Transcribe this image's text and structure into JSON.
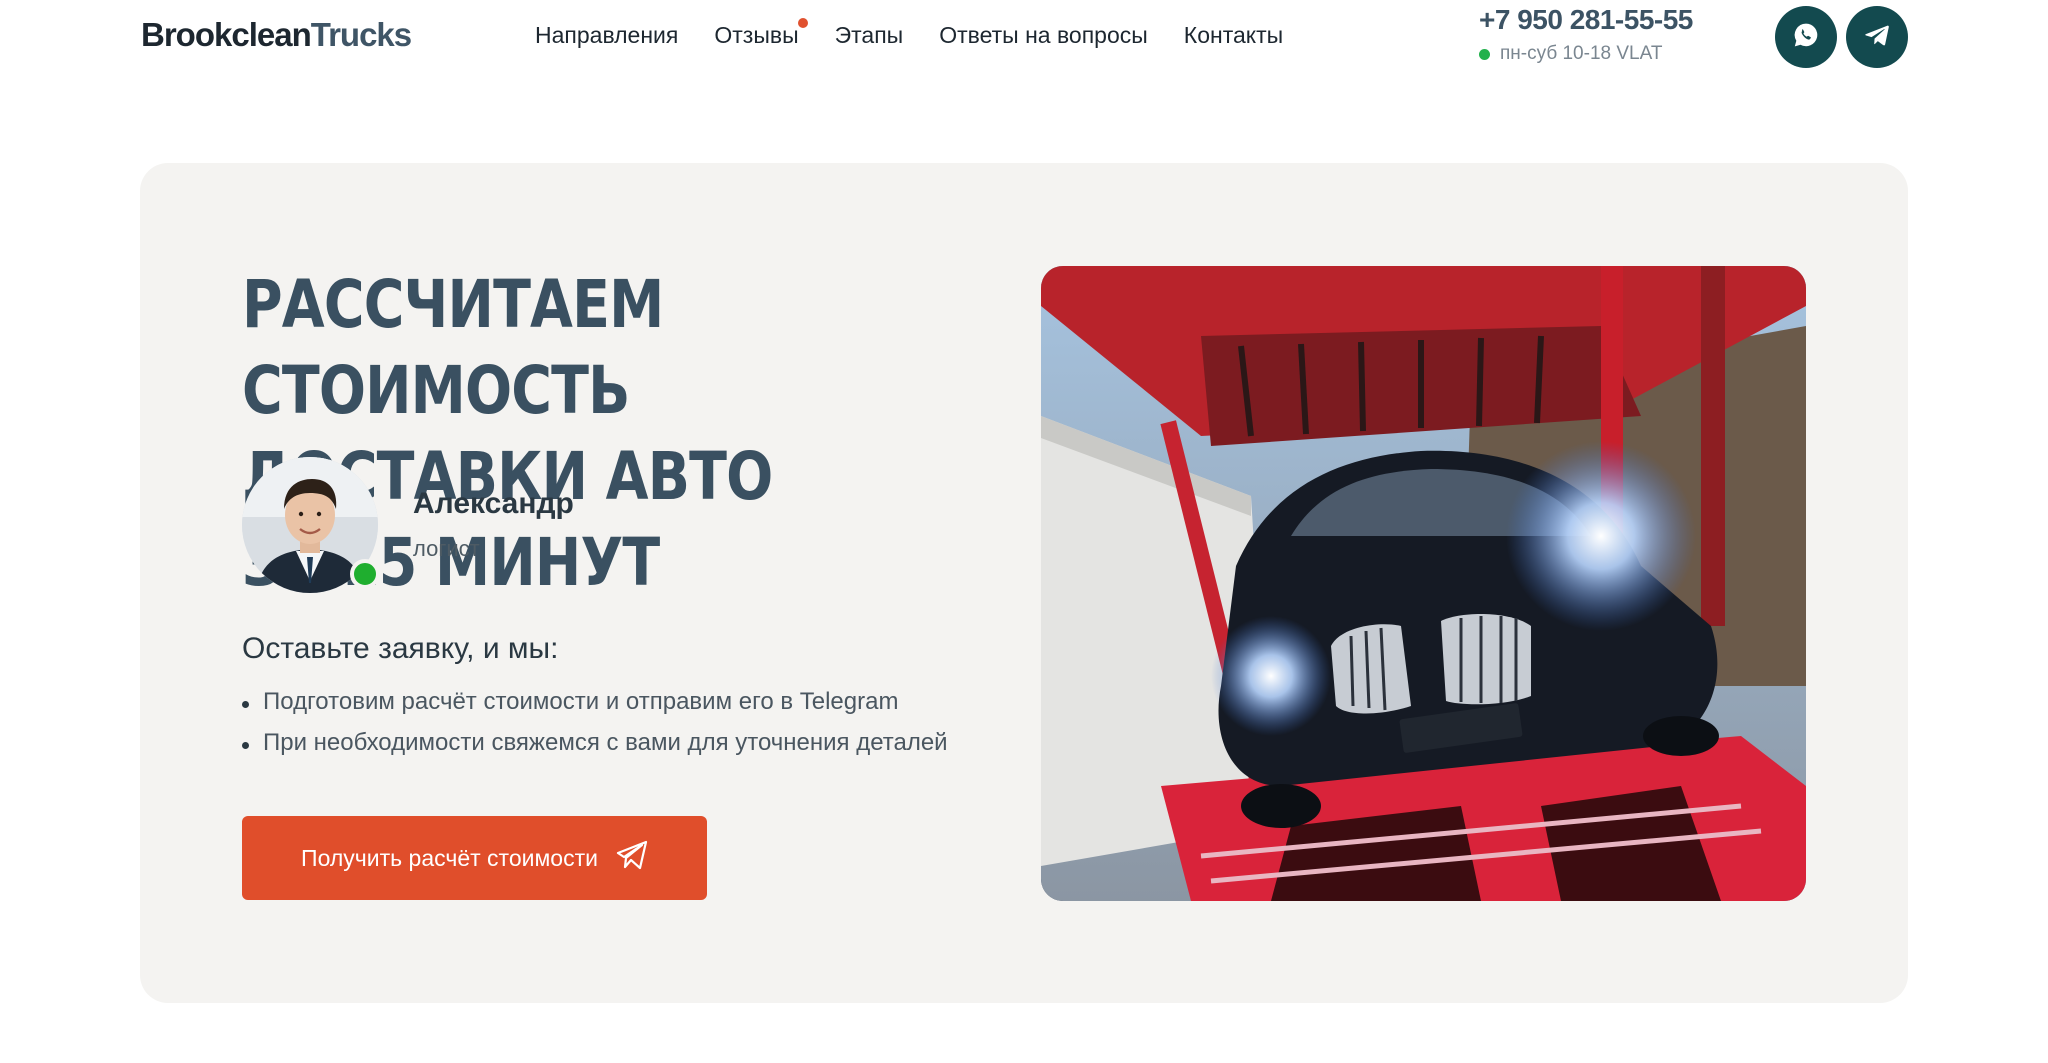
{
  "header": {
    "logo_part1": "Brookclean",
    "logo_part2": "Trucks",
    "nav": [
      {
        "label": "Направления"
      },
      {
        "label": "Отзывы"
      },
      {
        "label": "Этапы"
      },
      {
        "label": "Ответы на вопросы"
      },
      {
        "label": "Контакты"
      }
    ],
    "phone": "+7 950 281-55-55",
    "hours": "пн-суб 10-18 VLAT",
    "icons": [
      "whatsapp-icon",
      "telegram-icon"
    ]
  },
  "hero": {
    "title_line1": "Рассчитаем стоимость",
    "title_line2": "доставки авто за 15 минут",
    "person": {
      "name": "Александр",
      "role": "логист"
    },
    "subhead": "Оставьте заявку, и мы:",
    "bullets": [
      "Подготовим расчёт стоимости и отправим его в Telegram",
      "При необходимости свяжемся с вами для уточнения деталей"
    ],
    "cta_label": "Получить расчёт стоимости"
  },
  "colors": {
    "accent": "#e04e2b",
    "social_bg": "#134a4f",
    "card_bg": "#f4f3f1",
    "title": "#3a5061",
    "online": "#22b14c"
  }
}
